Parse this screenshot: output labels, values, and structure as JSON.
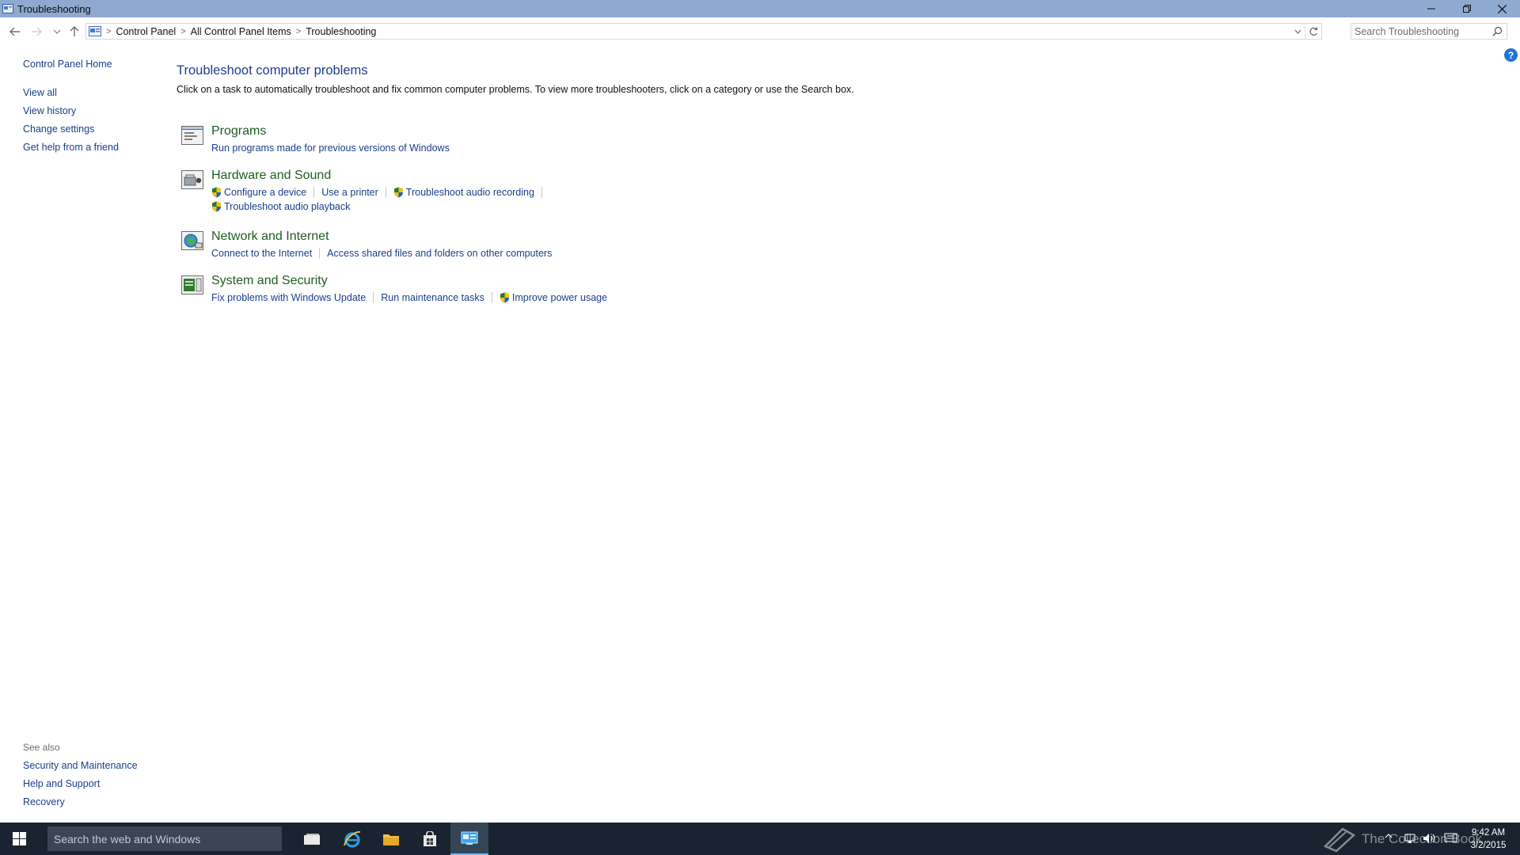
{
  "window": {
    "title": "Troubleshooting"
  },
  "addressbar": {
    "crumbs": [
      "Control Panel",
      "All Control Panel Items",
      "Troubleshooting"
    ],
    "search_placeholder": "Search Troubleshooting"
  },
  "leftpane": {
    "home": "Control Panel Home",
    "links": [
      "View all",
      "View history",
      "Change settings",
      "Get help from a friend"
    ]
  },
  "see_also": {
    "label": "See also",
    "links": [
      "Security and Maintenance",
      "Help and Support",
      "Recovery"
    ]
  },
  "main": {
    "title": "Troubleshoot computer problems",
    "description": "Click on a task to automatically troubleshoot and fix common computer problems. To view more troubleshooters, click on a category or use the Search box.",
    "categories": [
      {
        "title": "Programs",
        "icon": "programs-icon",
        "tasks": [
          "Run programs made for previous versions of Windows"
        ]
      },
      {
        "title": "Hardware and Sound",
        "icon": "hardware-sound-icon",
        "tasks": [
          "Configure a device",
          "Use a printer",
          "Troubleshoot audio recording",
          "Troubleshoot audio playback"
        ]
      },
      {
        "title": "Network and Internet",
        "icon": "network-internet-icon",
        "tasks": [
          "Connect to the Internet",
          "Access shared files and folders on other computers"
        ]
      },
      {
        "title": "System and Security",
        "icon": "system-security-icon",
        "tasks": [
          "Fix problems with Windows Update",
          "Run maintenance tasks",
          "Improve power usage"
        ]
      }
    ]
  },
  "taskbar": {
    "search_placeholder": "Search the web and Windows",
    "time": "9:42 AM",
    "date": "3/2/2015",
    "watermark": "The Collection Book"
  },
  "colors": {
    "titlebar": "#8fa9d1",
    "link": "#1a3e8c",
    "category_title": "#1e5d1e",
    "taskbar": "#1a2430"
  }
}
